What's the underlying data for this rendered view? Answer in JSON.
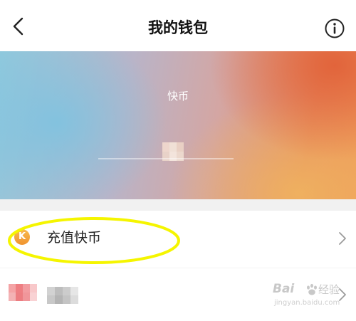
{
  "header": {
    "title": "我的钱包",
    "back_icon": "chevron-left-icon",
    "info_icon": "info-circle-icon"
  },
  "banner": {
    "currency_label": "快币"
  },
  "menu": {
    "recharge": {
      "icon": "k-coin-icon",
      "icon_letter": "K",
      "label": "充值快币"
    },
    "second_item": {
      "icon": "pixelated-icon"
    }
  },
  "watermark": {
    "brand_prefix": "Bai",
    "brand_suffix": "经验",
    "url": "jingyan.baidu.com"
  },
  "colors": {
    "highlight_ellipse": "#f5f500",
    "coin_orange": "#f0a030",
    "chevron": "#9a9a9a"
  }
}
